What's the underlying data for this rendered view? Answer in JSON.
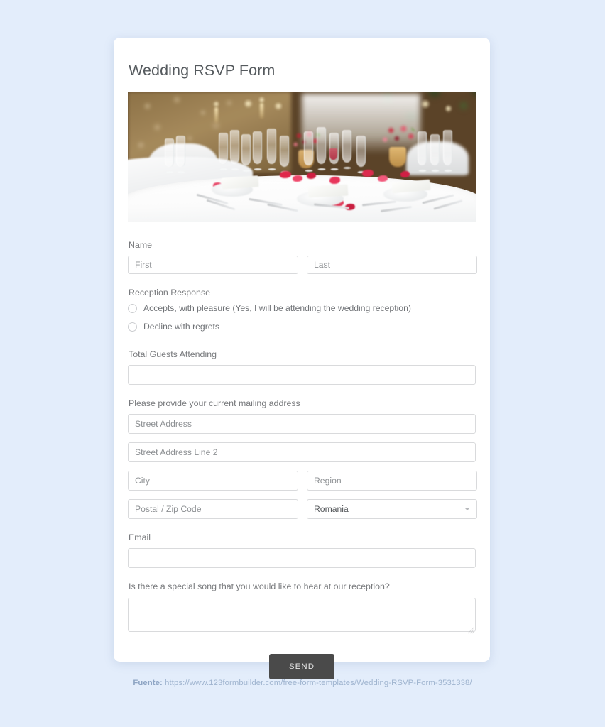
{
  "page": {
    "background_color": "#e3edfb",
    "card_background": "#ffffff"
  },
  "form": {
    "title": "Wedding RSVP Form",
    "hero_image_alt": "wedding reception banquet table with white tablecloth, wine glasses and red rose centerpieces",
    "name": {
      "label": "Name",
      "first_placeholder": "First",
      "first_value": "",
      "last_placeholder": "Last",
      "last_value": ""
    },
    "reception": {
      "label": "Reception Response",
      "options": [
        {
          "label": "Accepts, with pleasure (Yes, I will be attending the wedding reception)",
          "selected": false
        },
        {
          "label": "Decline with regrets",
          "selected": false
        }
      ]
    },
    "guests": {
      "label": "Total Guests Attending",
      "value": "",
      "placeholder": ""
    },
    "address": {
      "label": "Please provide your current mailing address",
      "street_placeholder": "Street Address",
      "street_value": "",
      "street2_placeholder": "Street Address Line 2",
      "street2_value": "",
      "city_placeholder": "City",
      "city_value": "",
      "region_placeholder": "Region",
      "region_value": "",
      "postal_placeholder": "Postal / Zip Code",
      "postal_value": "",
      "country_selected": "Romania",
      "country_caret_icon": "chevron-down-icon"
    },
    "email": {
      "label": "Email",
      "value": "",
      "placeholder": ""
    },
    "song": {
      "label": "Is there a special song that you would like to hear at our reception?",
      "value": "",
      "placeholder": ""
    },
    "submit": {
      "label": "SEND",
      "background_color": "#4a4a4a",
      "text_color": "#e8e8e8"
    }
  },
  "footer": {
    "prefix": "Fuente:",
    "url": "https://www.123formbuilder.com/free-form-templates/Wedding-RSVP-Form-3531338/"
  }
}
